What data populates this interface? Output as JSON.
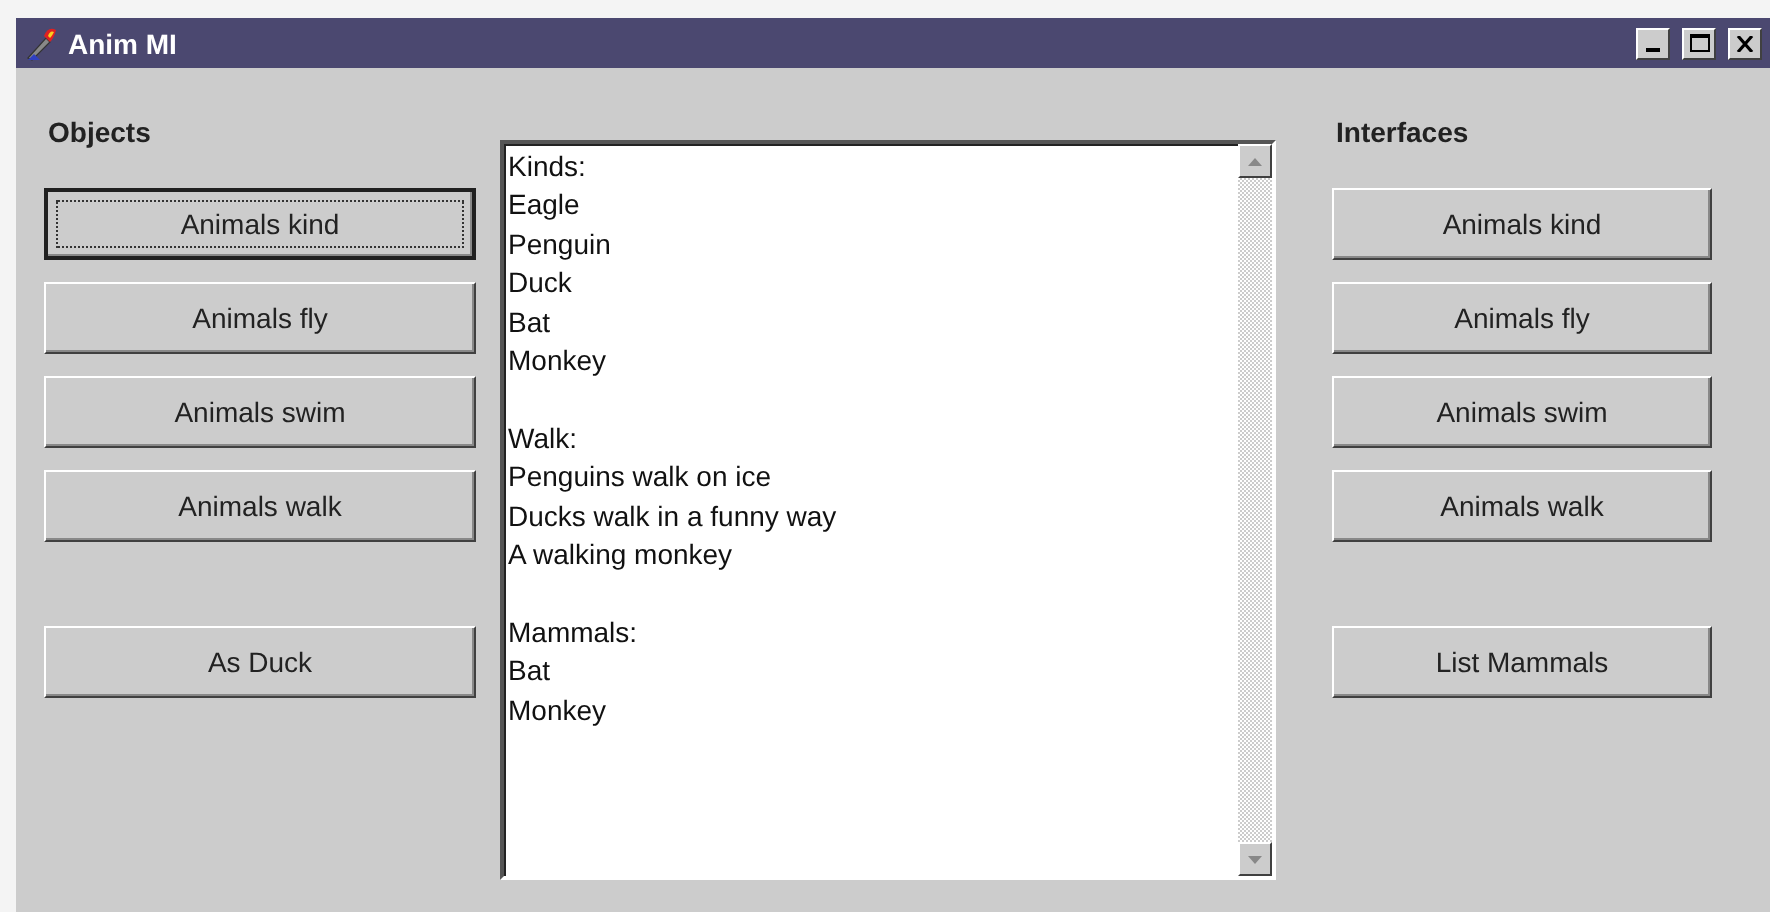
{
  "window": {
    "title": "Anim MI"
  },
  "objects": {
    "heading": "Objects",
    "groups": [
      [
        {
          "label": "Animals kind",
          "focused": true
        },
        {
          "label": "Animals fly",
          "focused": false
        },
        {
          "label": "Animals swim",
          "focused": false
        },
        {
          "label": "Animals walk",
          "focused": false
        }
      ],
      [
        {
          "label": "As Duck",
          "focused": false
        }
      ]
    ]
  },
  "output": {
    "sections": [
      {
        "heading": "Kinds:",
        "lines": [
          "Eagle",
          "Penguin",
          "Duck",
          "Bat",
          "Monkey"
        ]
      },
      {
        "heading": "Walk:",
        "lines": [
          "Penguins walk on ice",
          "Ducks walk in a funny way",
          "A walking monkey"
        ]
      },
      {
        "heading": "Mammals:",
        "lines": [
          "Bat",
          "Monkey"
        ]
      }
    ]
  },
  "interfaces": {
    "heading": "Interfaces",
    "groups": [
      [
        {
          "label": "Animals kind",
          "focused": false
        },
        {
          "label": "Animals fly",
          "focused": false
        },
        {
          "label": "Animals swim",
          "focused": false
        },
        {
          "label": "Animals walk",
          "focused": false
        }
      ],
      [
        {
          "label": "List Mammals",
          "focused": false
        }
      ]
    ]
  }
}
